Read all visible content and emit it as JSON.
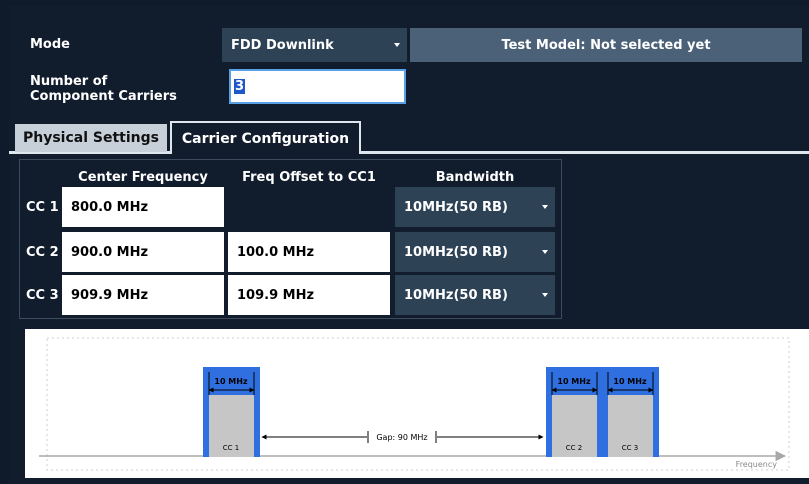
{
  "mode": {
    "label": "Mode",
    "value": "FDD Downlink"
  },
  "test_model_button": "Test Model: Not selected yet",
  "num_cc": {
    "label_line1": "Number of",
    "label_line2": "Component Carriers",
    "value": "3"
  },
  "tabs": [
    {
      "label": "Physical Settings"
    },
    {
      "label": "Carrier Configuration"
    }
  ],
  "table": {
    "headers": {
      "center": "Center Frequency",
      "offset": "Freq Offset to CC1",
      "bandwidth": "Bandwidth"
    },
    "rows": [
      {
        "label": "CC 1",
        "center": "800.0 MHz",
        "offset": "",
        "bandwidth": "10MHz(50 RB)"
      },
      {
        "label": "CC 2",
        "center": "900.0 MHz",
        "offset": "100.0 MHz",
        "bandwidth": "10MHz(50 RB)"
      },
      {
        "label": "CC 3",
        "center": "909.9 MHz",
        "offset": "109.9 MHz",
        "bandwidth": "10MHz(50 RB)"
      }
    ]
  },
  "diagram": {
    "carriers": [
      {
        "name": "CC 1",
        "bw": "10 MHz"
      },
      {
        "name": "CC 2",
        "bw": "10 MHz"
      },
      {
        "name": "CC 3",
        "bw": "10 MHz"
      }
    ],
    "gap_label": "Gap: 90 MHz",
    "axis_label": "Frequency",
    "colors": {
      "carrier_edge": "#2f6fe0",
      "carrier_body": "#c6c6c6"
    }
  }
}
